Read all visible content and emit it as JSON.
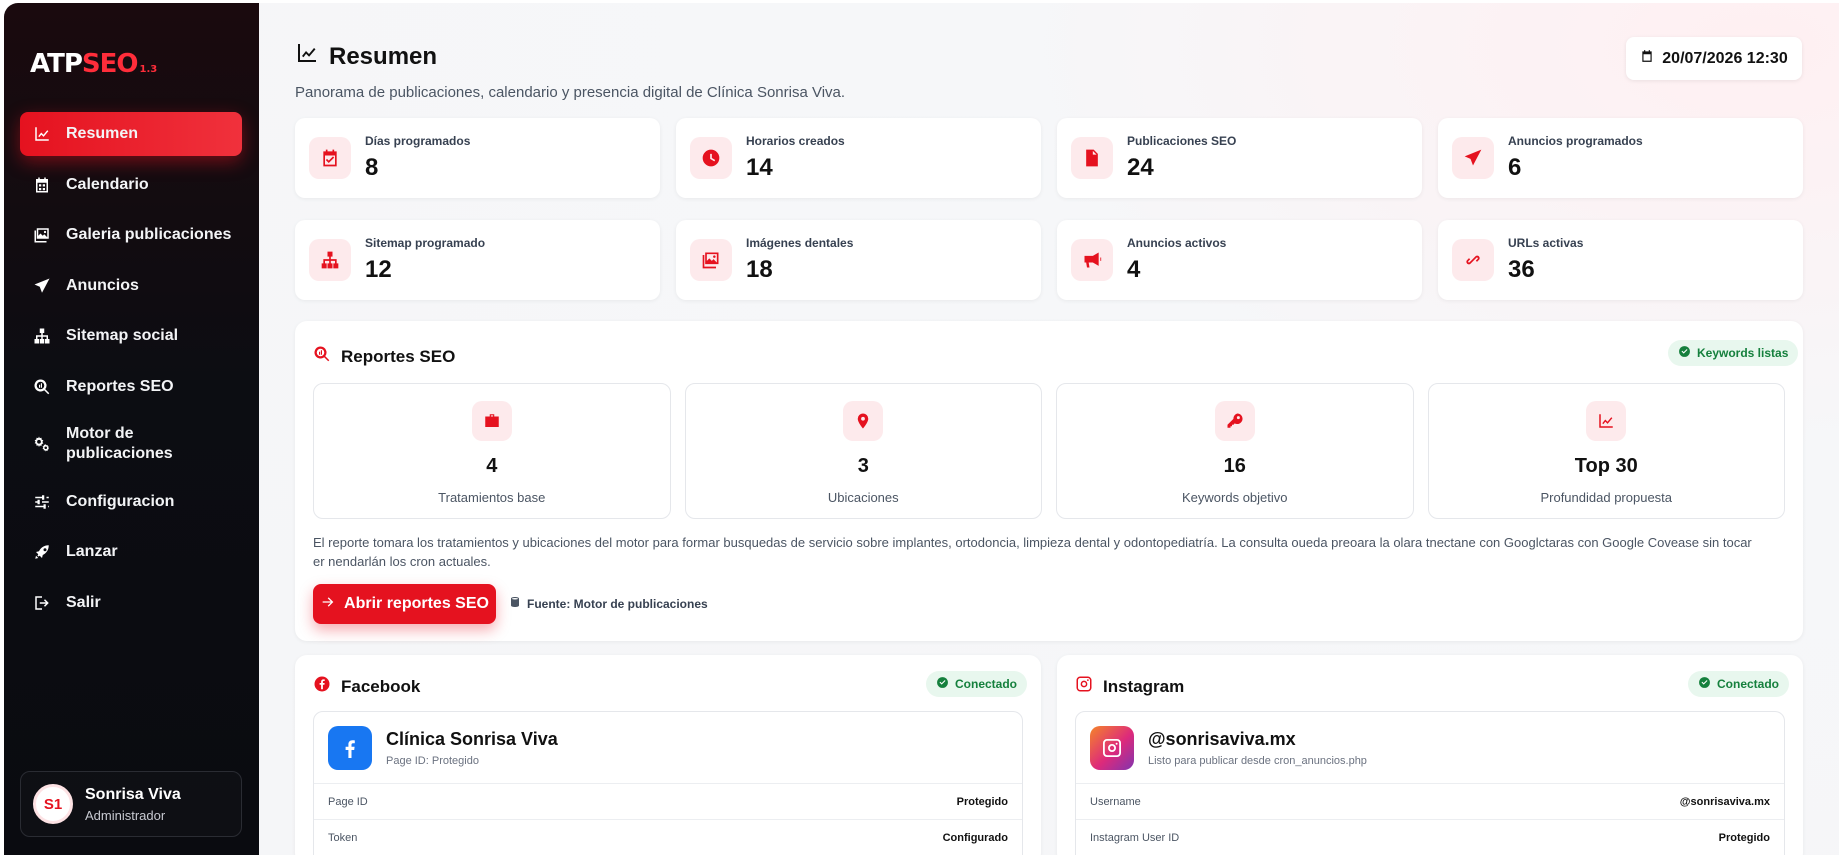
{
  "brand": {
    "atp": "ATP",
    "seo": "SEO",
    "version": "1.3"
  },
  "sidebar": {
    "items": [
      {
        "label": "Resumen",
        "icon": "chart-line-icon",
        "active": true
      },
      {
        "label": "Calendario",
        "icon": "calendar-icon"
      },
      {
        "label": "Galeria publicaciones",
        "icon": "images-icon"
      },
      {
        "label": "Anuncios",
        "icon": "paper-plane-icon"
      },
      {
        "label": "Sitemap social",
        "icon": "sitemap-icon"
      },
      {
        "label": "Reportes SEO",
        "icon": "search-chart-icon"
      },
      {
        "label": "Motor de publicaciones",
        "icon": "gears-icon"
      },
      {
        "label": "Configuracion",
        "icon": "sliders-icon"
      },
      {
        "label": "Lanzar",
        "icon": "rocket-icon"
      },
      {
        "label": "Salir",
        "icon": "logout-icon"
      }
    ],
    "user": {
      "initials": "S1",
      "name": "Sonrisa Viva",
      "role": "Administrador"
    }
  },
  "header": {
    "title": "Resumen",
    "subtitle": "Panorama de publicaciones, calendario y presencia digital de Clínica Sonrisa Viva.",
    "datetime": "20/07/2026 12:30"
  },
  "stats": [
    {
      "label": "Días programados",
      "value": "8",
      "icon": "calendar-check-icon"
    },
    {
      "label": "Horarios creados",
      "value": "14",
      "icon": "clock-icon"
    },
    {
      "label": "Publicaciones SEO",
      "value": "24",
      "icon": "document-icon"
    },
    {
      "label": "Anuncios programados",
      "value": "6",
      "icon": "paper-plane-icon"
    },
    {
      "label": "Sitemap programado",
      "value": "12",
      "icon": "sitemap-icon"
    },
    {
      "label": "Imágenes dentales",
      "value": "18",
      "icon": "images-icon"
    },
    {
      "label": "Anuncios activos",
      "value": "4",
      "icon": "megaphone-icon"
    },
    {
      "label": "URLs activas",
      "value": "36",
      "icon": "link-icon"
    }
  ],
  "seo": {
    "title": "Reportes SEO",
    "badge": "Keywords listas",
    "metrics": [
      {
        "value": "4",
        "label": "Tratamientos base",
        "icon": "briefcase-icon"
      },
      {
        "value": "3",
        "label": "Ubicaciones",
        "icon": "location-pin-icon"
      },
      {
        "value": "16",
        "label": "Keywords objetivo",
        "icon": "key-icon"
      },
      {
        "value": "Top 30",
        "label": "Profundidad propuesta",
        "icon": "chart-line-icon"
      }
    ],
    "description": "El reporte tomara los tratamientos y ubicaciones del motor para formar busquedas de servicio sobre implantes, ortodoncia, limpieza dental y odontopediatría. La consulta oueda preoara la olara tnectane con Googlctaras con Google Covease sin tocar er nendarlán los cron actuales.",
    "cta": "Abrir reportes SEO",
    "source": "Fuente: Motor de publicaciones"
  },
  "facebook": {
    "title": "Facebook",
    "status": "Conectado",
    "name": "Clínica Sonrisa Viva",
    "sub": "Page ID: Protegido",
    "rows": [
      {
        "key": "Page ID",
        "value": "Protegido"
      },
      {
        "key": "Token",
        "value": "Configurado"
      }
    ]
  },
  "instagram": {
    "title": "Instagram",
    "status": "Conectado",
    "name": "@sonrisaviva.mx",
    "sub": "Listo para publicar desde cron_anuncios.php",
    "rows": [
      {
        "key": "Username",
        "value": "@sonrisaviva.mx"
      },
      {
        "key": "Instagram User ID",
        "value": "Protegido"
      }
    ]
  },
  "colors": {
    "accent": "#e5121f",
    "success": "#15803d",
    "sidebar": "#0c0d12",
    "facebook": "#1877f2"
  }
}
